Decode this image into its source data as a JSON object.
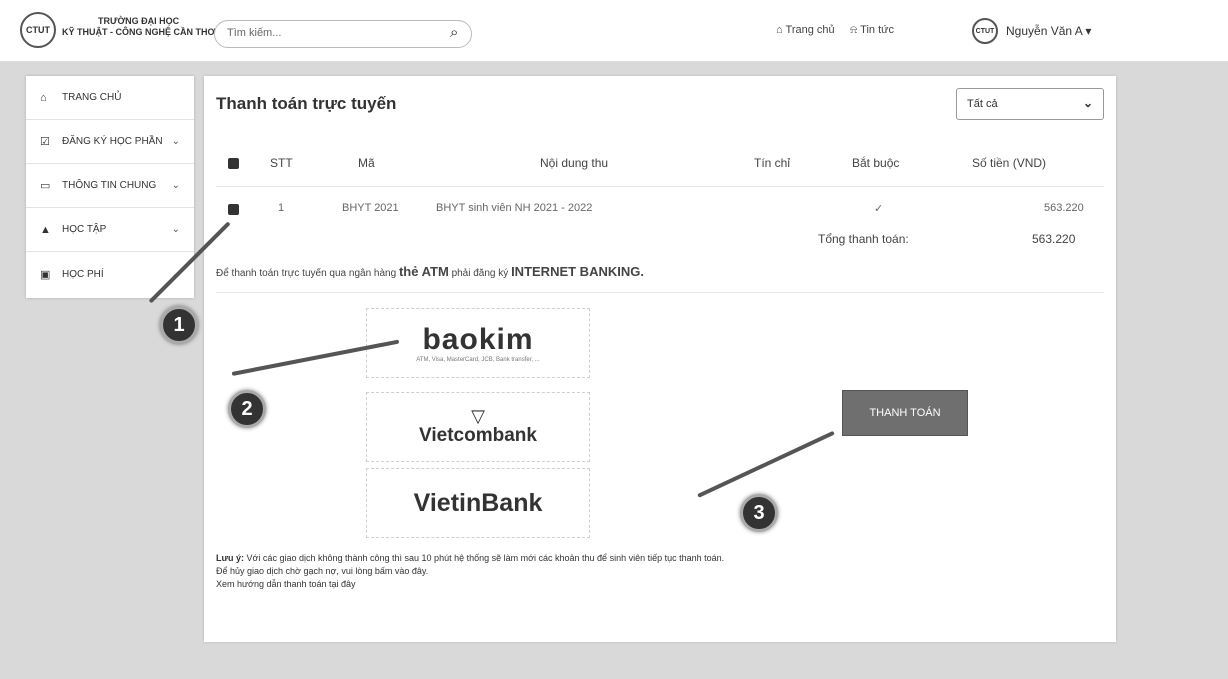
{
  "header": {
    "logo_text": "CTUT",
    "school_line1": "TRƯỜNG ĐẠI HỌC",
    "school_line2": "KỸ THUẬT - CÔNG NGHỆ CẦN THƠ",
    "search_placeholder": "Tìm kiếm...",
    "nav_home": "Trang chủ",
    "nav_news": "Tin tức",
    "user_name": "Nguyễn Văn A",
    "icons": [
      "search-icon",
      "home-icon",
      "bell-icon",
      "chevron-down-icon"
    ]
  },
  "sidebar": {
    "items": [
      {
        "label": "TRANG CHỦ",
        "icon": "home-icon"
      },
      {
        "label": "ĐĂNG KÝ HỌC PHẦN",
        "icon": "check-square-icon"
      },
      {
        "label": "THÔNG TIN CHUNG",
        "icon": "monitor-icon"
      },
      {
        "label": "HỌC TẬP",
        "icon": "graduation-cap-icon"
      },
      {
        "label": "HỌC PHÍ",
        "icon": "money-icon"
      }
    ]
  },
  "main": {
    "title": "Thanh toán trực tuyến",
    "filter_value": "Tất cả",
    "table": {
      "headers": [
        "STT",
        "Mã",
        "Nội dung thu",
        "Tín chỉ",
        "Bắt buộc",
        "Số tiền (VND)"
      ],
      "rows": [
        {
          "stt": "1",
          "ma": "BHYT 2021",
          "noi_dung": "BHYT sinh viên NH 2021 - 2022",
          "tin_chi": "",
          "bat_buoc": "✓",
          "so_tien": "563.220"
        }
      ],
      "total_label": "Tổng thanh toán:",
      "total_value": "563.220"
    },
    "bank_note_prefix": "Để thanh toán trực tuyến qua ngân hàng",
    "bank_note_atm": "thẻ ATM",
    "bank_note_mid": "phải đăng ký",
    "bank_note_ib": "INTERNET BANKING.",
    "banks": [
      {
        "name": "baokim",
        "sub": "ATM, Visa, MasterCard, JCB, Bank transfer, ..."
      },
      {
        "name": "Vietcombank",
        "sub": ""
      },
      {
        "name": "VietinBank",
        "sub": ""
      }
    ],
    "pay_button": "THANH TOÁN",
    "note_label": "Lưu ý:",
    "note_line1": "Với các giao dịch không thành công thì sau 10 phút hệ thống sẽ làm mới các khoản thu để sinh viên tiếp tục thanh toán.",
    "note_line2": "Để hủy giao dịch chờ gạch nợ, vui lòng bấm vào đây.",
    "note_line3": "Xem hướng dẫn thanh toán tại đây"
  },
  "markers": [
    "1",
    "2",
    "3"
  ]
}
